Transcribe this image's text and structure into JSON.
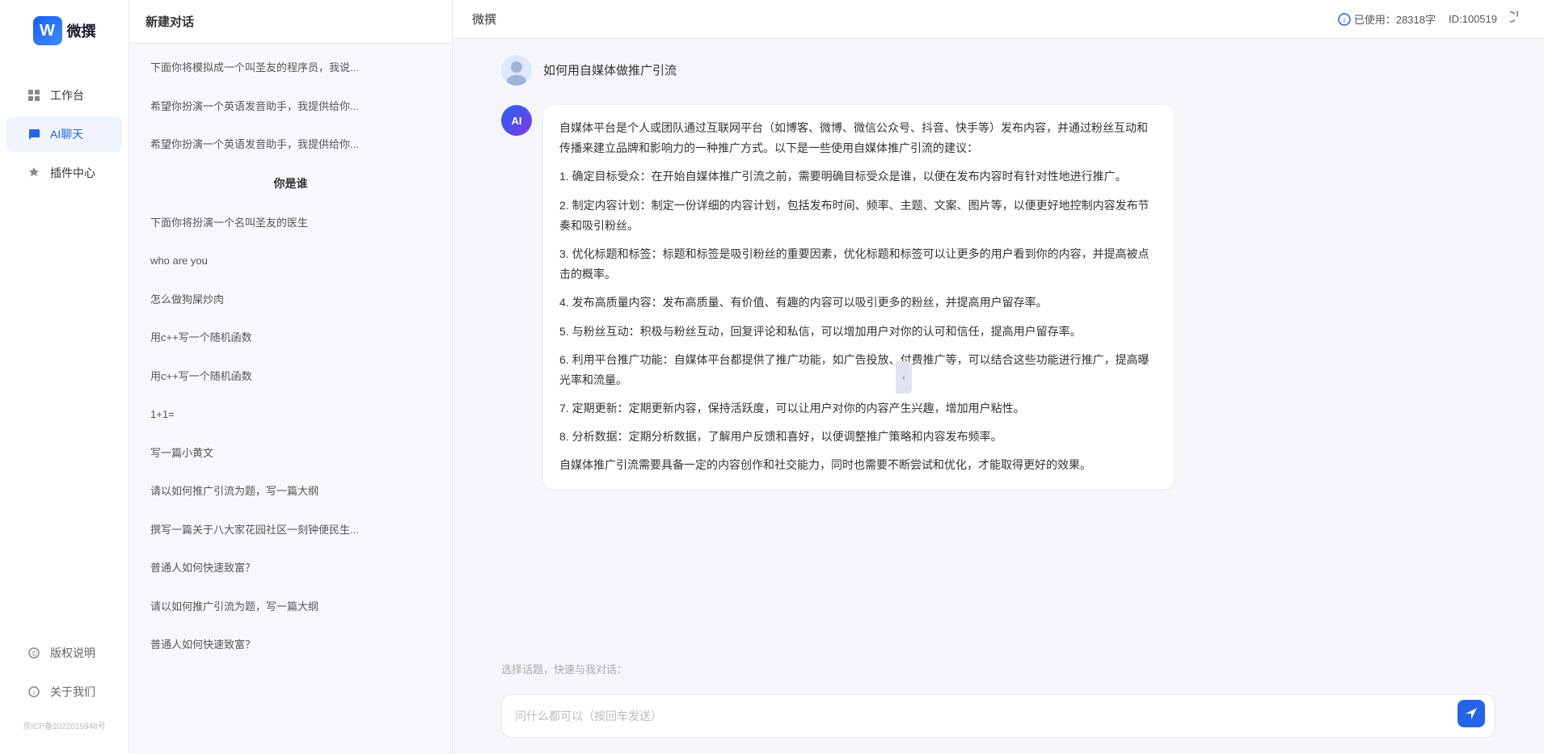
{
  "app": {
    "title": "微撰",
    "logo_letter": "W",
    "logo_text": "微撰"
  },
  "header": {
    "title": "微撰",
    "usage_icon": "info-icon",
    "usage_label": "已使用：28318字",
    "id_label": "ID:100519",
    "power_icon": "power-icon"
  },
  "sidebar": {
    "nav_items": [
      {
        "id": "workbench",
        "label": "工作台",
        "icon": "grid-icon"
      },
      {
        "id": "ai-chat",
        "label": "AI聊天",
        "icon": "chat-icon",
        "active": true
      },
      {
        "id": "plugin-center",
        "label": "插件中心",
        "icon": "plugin-icon"
      }
    ],
    "bottom_items": [
      {
        "id": "copyright",
        "label": "版权说明",
        "icon": "copyright-icon"
      },
      {
        "id": "about",
        "label": "关于我们",
        "icon": "about-icon"
      }
    ],
    "icp": "京ICP备2022015948号"
  },
  "middle_panel": {
    "header": "新建对话",
    "chat_items": [
      {
        "id": "chat-1",
        "text": "下面你将模拟成一个叫圣友的程序员，我说..."
      },
      {
        "id": "chat-2",
        "text": "希望你扮演一个英语发音助手，我提供给你..."
      },
      {
        "id": "chat-3",
        "text": "希望你扮演一个英语发音助手，我提供给你..."
      },
      {
        "id": "chat-4",
        "text": "你是谁",
        "section_header": true
      },
      {
        "id": "chat-5",
        "text": "下面你将扮演一个名叫圣友的医生"
      },
      {
        "id": "chat-6",
        "text": "who are you"
      },
      {
        "id": "chat-7",
        "text": "怎么做狗屎炒肉"
      },
      {
        "id": "chat-8",
        "text": "用c++写一个随机函数"
      },
      {
        "id": "chat-9",
        "text": "用c++写一个随机函数"
      },
      {
        "id": "chat-10",
        "text": "1+1="
      },
      {
        "id": "chat-11",
        "text": "写一篇小黄文"
      },
      {
        "id": "chat-12",
        "text": "请以如何推广引流为题，写一篇大纲"
      },
      {
        "id": "chat-13",
        "text": "撰写一篇关于八大家花园社区一刻钟便民生..."
      },
      {
        "id": "chat-14",
        "text": "普通人如何快速致富？"
      },
      {
        "id": "chat-15",
        "text": "请以如何推广引流为题，写一篇大纲"
      },
      {
        "id": "chat-16",
        "text": "普通人如何快速致富？"
      }
    ]
  },
  "chat": {
    "messages": [
      {
        "id": "msg-1",
        "role": "user",
        "avatar_type": "user",
        "text": "如何用自媒体做推广引流"
      },
      {
        "id": "msg-2",
        "role": "assistant",
        "avatar_type": "ai",
        "paragraphs": [
          "自媒体平台是个人或团队通过互联网平台（如博客、微博、微信公众号、抖音、快手等）发布内容，并通过粉丝互动和传播来建立品牌和影响力的一种推广方式。以下是一些使用自媒体推广引流的建议：",
          "1. 确定目标受众：在开始自媒体推广引流之前，需要明确目标受众是谁，以便在发布内容时有针对性地进行推广。",
          "2. 制定内容计划：制定一份详细的内容计划，包括发布时间、频率、主题、文案、图片等，以便更好地控制内容发布节奏和吸引粉丝。",
          "3. 优化标题和标签：标题和标签是吸引粉丝的重要因素，优化标题和标签可以让更多的用户看到你的内容，并提高被点击的概率。",
          "4. 发布高质量内容：发布高质量、有价值、有趣的内容可以吸引更多的粉丝，并提高用户留存率。",
          "5. 与粉丝互动：积极与粉丝互动，回复评论和私信，可以增加用户对你的认可和信任，提高用户留存率。",
          "6. 利用平台推广功能：自媒体平台都提供了推广功能，如广告投放、付费推广等，可以结合这些功能进行推广，提高曝光率和流量。",
          "7. 定期更新：定期更新内容，保持活跃度，可以让用户对你的内容产生兴趣，增加用户粘性。",
          "8. 分析数据：定期分析数据，了解用户反馈和喜好，以便调整推广策略和内容发布频率。",
          "自媒体推广引流需要具备一定的内容创作和社交能力，同时也需要不断尝试和优化，才能取得更好的效果。"
        ]
      }
    ],
    "quick_label": "选择话题，快速与我对话：",
    "input_placeholder": "问什么都可以（按回车发送）",
    "send_icon": "send-icon"
  }
}
